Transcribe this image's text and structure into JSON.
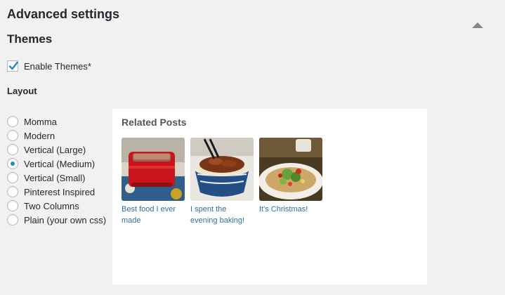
{
  "section": {
    "title": "Advanced settings",
    "toggle_icon": "triangle-up-icon"
  },
  "themes": {
    "title": "Themes",
    "enable_label": "Enable Themes*",
    "enable_checked": true
  },
  "layout": {
    "label": "Layout",
    "selected": "Vertical (Medium)",
    "options": [
      {
        "label": "Momma",
        "checked": false
      },
      {
        "label": "Modern",
        "checked": false
      },
      {
        "label": "Vertical (Large)",
        "checked": false
      },
      {
        "label": "Vertical (Medium)",
        "checked": true
      },
      {
        "label": "Vertical (Small)",
        "checked": false
      },
      {
        "label": "Pinterest Inspired",
        "checked": false
      },
      {
        "label": "Two Columns",
        "checked": false
      },
      {
        "label": "Plain (your own css)",
        "checked": false
      }
    ]
  },
  "preview": {
    "title": "Related Posts",
    "posts": [
      {
        "title": "Best food I ever made",
        "image": "meatloaf-in-red-dish"
      },
      {
        "title": "I spent the evening baking!",
        "image": "noodle-bowl-with-chopsticks"
      },
      {
        "title": "It's Christmas!",
        "image": "salad-on-plate"
      }
    ]
  },
  "colors": {
    "accent": "#1e8cbe",
    "link": "#2a6e9e",
    "background": "#f1f1f1"
  }
}
